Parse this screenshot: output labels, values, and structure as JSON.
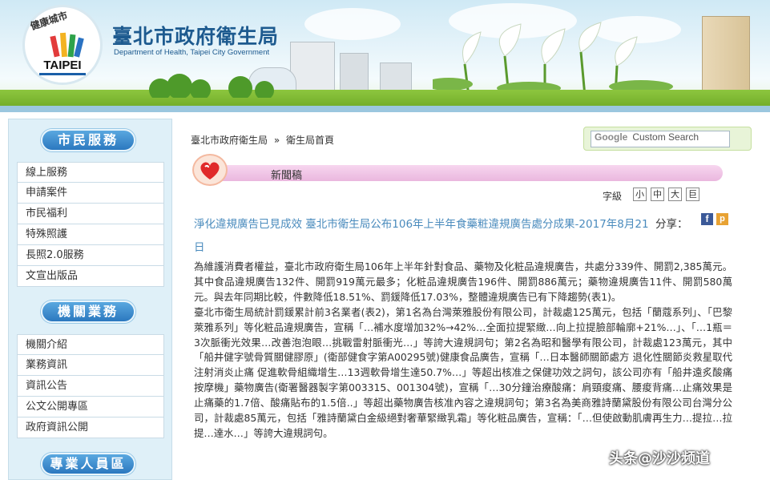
{
  "header": {
    "logo_tag": "健康城市",
    "logo_text": "TAIPEI",
    "title": "臺北市政府衛生局",
    "subtitle": "Department of Health, Taipei City Government"
  },
  "sidebar": {
    "sections": [
      {
        "title": "市民服務",
        "items": [
          "線上服務",
          "申請案件",
          "市民福利",
          "特殊照護",
          "長照2.0服務",
          "文宣出版品"
        ]
      },
      {
        "title": "機關業務",
        "items": [
          "機關介紹",
          "業務資訊",
          "資訊公告",
          "公文公開專區",
          "政府資訊公開"
        ]
      },
      {
        "title": "專業人員區",
        "items": []
      }
    ]
  },
  "breadcrumb": {
    "items": [
      "臺北市政府衛生局",
      "»",
      "衛生局首頁"
    ]
  },
  "search": {
    "brand": "Google",
    "placeholder": "Custom Search"
  },
  "news": {
    "label": "新聞稿"
  },
  "font_size": {
    "label": "字級",
    "small": "小",
    "medium": "中",
    "large": "大",
    "huge": "巨"
  },
  "article": {
    "title": "淨化違規廣告已見成效 臺北市衛生局公布106年上半年食藥粧違規廣告處分成果-2017年8月21日",
    "share_label": "分享：",
    "paragraphs": [
      "為維護消費者權益，臺北市政府衛生局106年上半年針對食品、藥物及化粧品違規廣告，共處分339件、開罰2,385萬元。其中食品違規廣告132件、開罰919萬元最多；化粧品違規廣告196件、開罰886萬元；藥物違規廣告11件、開罰580萬元。與去年同期比較，件數降低18.51%、罰鍰降低17.03%，整體違規廣告已有下降趨勢(表1)。",
      "臺北市衛生局統計罰鍰累計前3名業者(表2)，第1名為台灣萊雅股份有限公司，計裁處125萬元，包括「蘭蔻系列」、「巴黎萊雅系列」等化粧品違規廣告，宣稱「…補水度增加32%→42%…全面拉提緊緻…向上拉提臉部輪廓+21%…」、「…1瓶＝3次脈衝光效果…改善泡泡眼…挑戰雷射脈衝光…」等誇大違規詞句；第2名為昭和醫學有限公司，計裁處123萬元，其中「船井健字號骨質關健膠原」(衛部健食字第A00295號)健康食品廣告，宣稱「…日本醫師關節處方 退化性關節炎救星取代注射消炎止痛 促進軟骨組織增生…13週軟骨增生達50.7%…」等超出核准之保健功效之詞句，該公司亦有「船井遠炙酸痛按摩機」藥物廣告(衛署醫器製字第003315、001304號)，宣稱「…30分鐘治療酸痛：肩頸痠痛、腰痠背痛…止痛效果是止痛藥的1.7倍、酸痛貼布的1.5倍..」等超出藥物廣告核准內容之違規詞句；第3名為美商雅詩蘭黛股份有限公司台灣分公司，計裁處85萬元，包括「雅詩蘭黛白金級絕對奢華緊緻乳霜」等化粧品廣告，宣稱：「…但使啟動肌膚再生力…提拉…拉提…達水…」等誇大違規詞句。"
    ]
  },
  "watermark": "头条@沙沙频道",
  "colors": {
    "accent": "#4a8bbd",
    "sidebar_bg": "#dff0f8",
    "section_head": "#2b78bf",
    "news_bar": "#eab7de"
  }
}
